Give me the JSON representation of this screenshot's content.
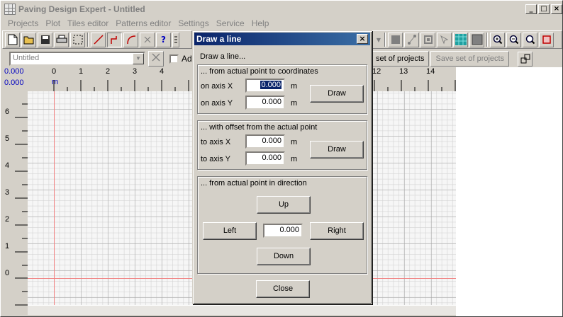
{
  "window": {
    "title": "Paving Design Expert - Untitled",
    "controls": {
      "minimize": "_",
      "maximize": "□",
      "close": "×"
    }
  },
  "menu": [
    "Projects",
    "Plot",
    "Tiles editor",
    "Patterns editor",
    "Settings",
    "Service",
    "Help"
  ],
  "toolbar2": {
    "project_value": "Untitled",
    "checkbox_label": "Ad",
    "btn_set_projects": "set of projects",
    "btn_save_set": "Save set of projects"
  },
  "ruler": {
    "readout_x": "0.000",
    "readout_y": "0.000",
    "unit_label": "m",
    "x_ticks": [
      "0",
      "1",
      "2",
      "3",
      "4",
      "12",
      "13",
      "14"
    ],
    "y_ticks": [
      "6",
      "5",
      "4",
      "3",
      "2",
      "1",
      "0"
    ]
  },
  "dialog": {
    "title": "Draw a line",
    "close_glyph": "×",
    "heading": "Draw a line...",
    "coords": {
      "caption": "... from actual point to coordinates",
      "x_label": "on axis X",
      "y_label": "on axis Y",
      "x_value": "0.000",
      "y_value": "0.000",
      "unit": "m",
      "draw_label": "Draw"
    },
    "offset": {
      "caption": "... with offset from the actual point",
      "x_label": "to axis X",
      "y_label": "to axis Y",
      "x_value": "0.000",
      "y_value": "0.000",
      "unit": "m",
      "draw_label": "Draw"
    },
    "direction": {
      "caption": "... from actual point in direction",
      "up": "Up",
      "left": "Left",
      "right": "Right",
      "down": "Down",
      "value": "0.000"
    },
    "close_label": "Close"
  },
  "icons": {
    "toolbar": [
      "new-file-icon",
      "open-folder-icon",
      "save-icon",
      "print-icon",
      "select-rect-icon",
      "line-icon",
      "polyline-icon",
      "arc-icon",
      "tool-icon",
      "help-icon",
      "list-icon"
    ],
    "toolbar_right": [
      "dropdown-icon",
      "fill-icon",
      "nodes-icon",
      "square-icon",
      "pointer-icon",
      "texture-icon",
      "gray-square-icon",
      "zoom-in-icon",
      "zoom-out-icon",
      "zoom-fit-icon",
      "frame-icon"
    ]
  }
}
